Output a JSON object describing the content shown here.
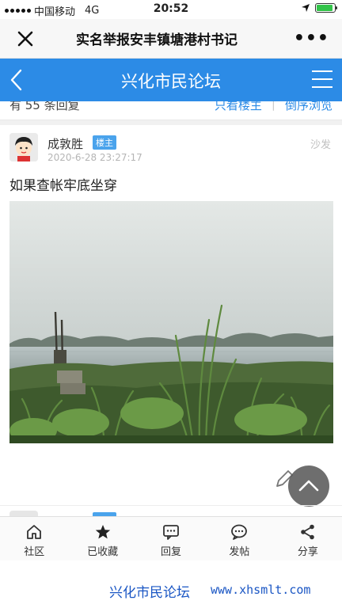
{
  "status_bar": {
    "carrier": "中国移动",
    "network": "4G",
    "time": "20:52"
  },
  "webview": {
    "title": "实名举报安丰镇塘港村书记",
    "more": "•••"
  },
  "forum_nav": {
    "title": "兴化市民论坛"
  },
  "reply_bar": {
    "count_text": "有 55 条回复",
    "only_op": "只看楼主",
    "reverse": "倒序浏览"
  },
  "post": {
    "author": "成敦胜",
    "badge": "楼主",
    "time": "2020-6-28 23:27:17",
    "floor": "沙发",
    "text": "如果查帐牢底坐穿",
    "image_description_icon": "photo-river-reeds"
  },
  "toolbar": {
    "items": [
      {
        "label": "社区",
        "icon": "home-icon"
      },
      {
        "label": "已收藏",
        "icon": "star-icon"
      },
      {
        "label": "回复",
        "icon": "reply-icon"
      },
      {
        "label": "发帖",
        "icon": "post-icon"
      },
      {
        "label": "分享",
        "icon": "share-icon"
      }
    ]
  },
  "watermark": {
    "forum": "兴化市民论坛",
    "url": "www.xhsmlt.com"
  },
  "colors": {
    "nav_blue": "#2c8be6",
    "badge_blue": "#4aa3ec",
    "watermark_blue": "#1a56c4"
  }
}
